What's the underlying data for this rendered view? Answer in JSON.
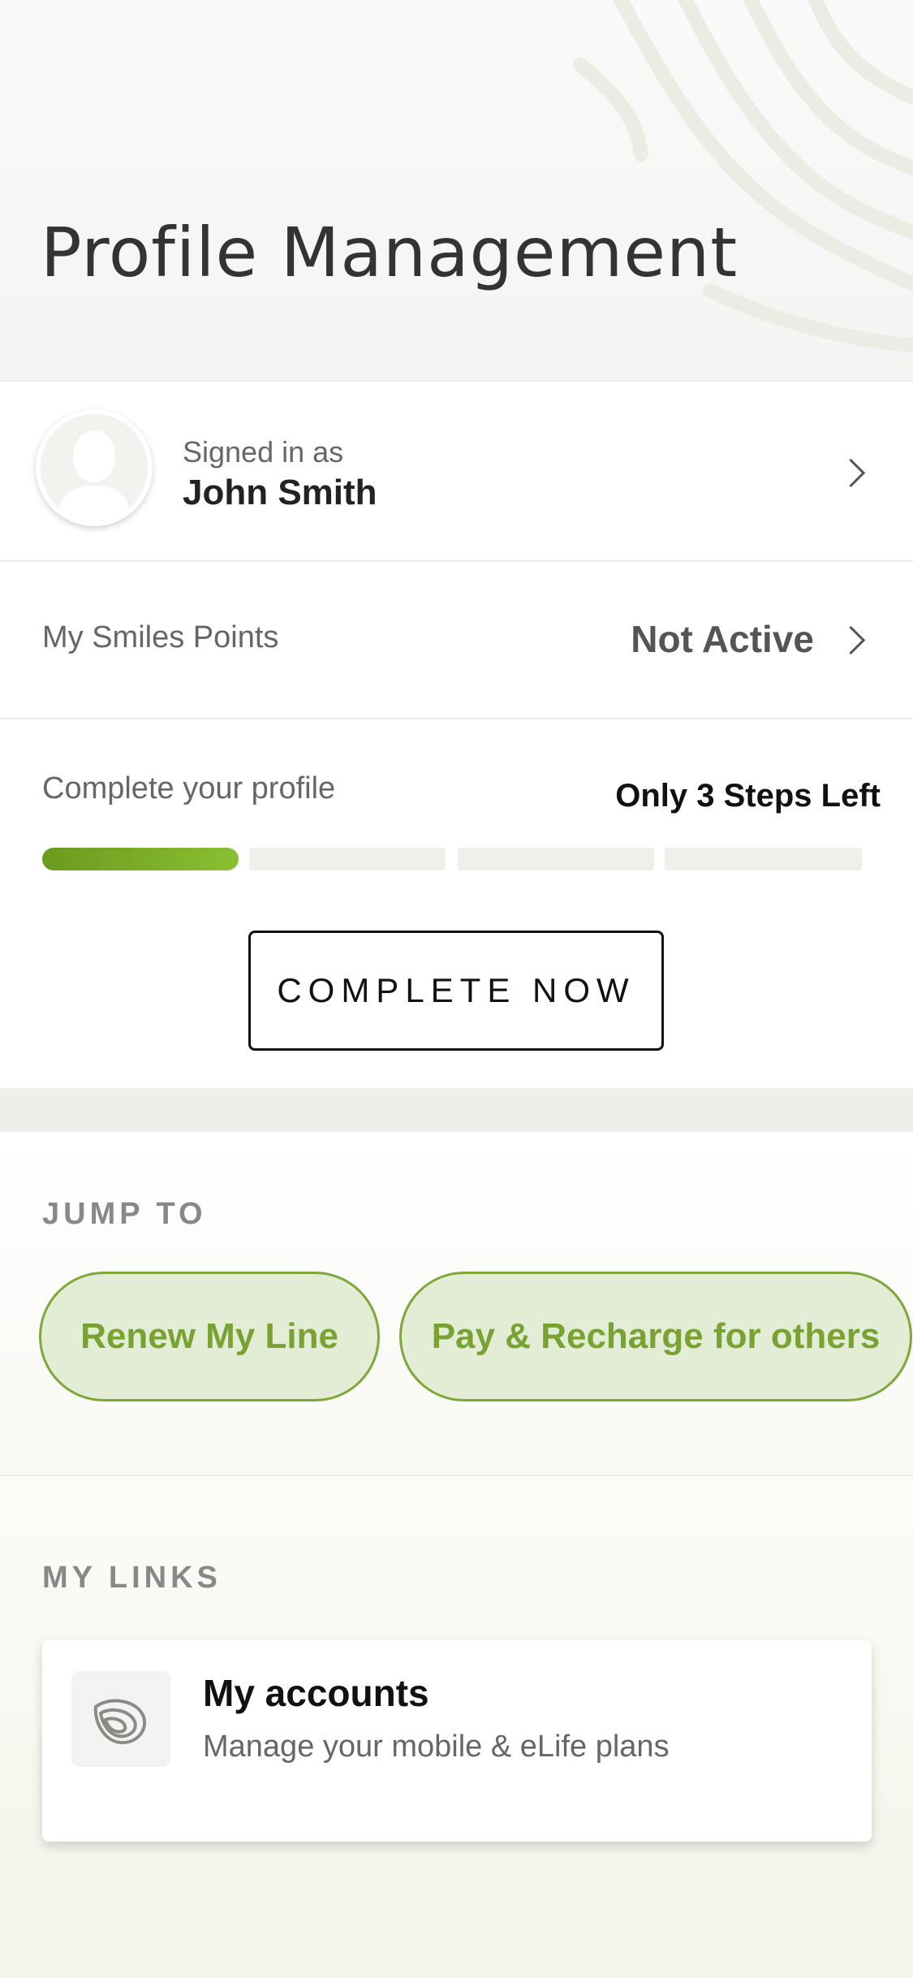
{
  "header": {
    "title": "Profile Management"
  },
  "profile": {
    "signed_in_label": "Signed in as",
    "name": "John Smith"
  },
  "points": {
    "label": "My Smiles Points",
    "value": "Not Active"
  },
  "completion": {
    "label": "Complete your profile",
    "steps_left": "Only 3 Steps Left",
    "steps_total": 4,
    "steps_done": 1,
    "button": "COMPLETE NOW"
  },
  "jump_to": {
    "label": "JUMP TO",
    "items": [
      {
        "label": "Renew My Line"
      },
      {
        "label": "Pay & Recharge for others"
      }
    ]
  },
  "my_links": {
    "label": "MY LINKS",
    "items": [
      {
        "title": "My accounts",
        "subtitle": "Manage your mobile & eLife plans",
        "icon": "accounts-icon"
      }
    ]
  },
  "colors": {
    "accent": "#7ea83a",
    "pill_bg": "#e3ecd4",
    "progress": "#7aaf28"
  }
}
